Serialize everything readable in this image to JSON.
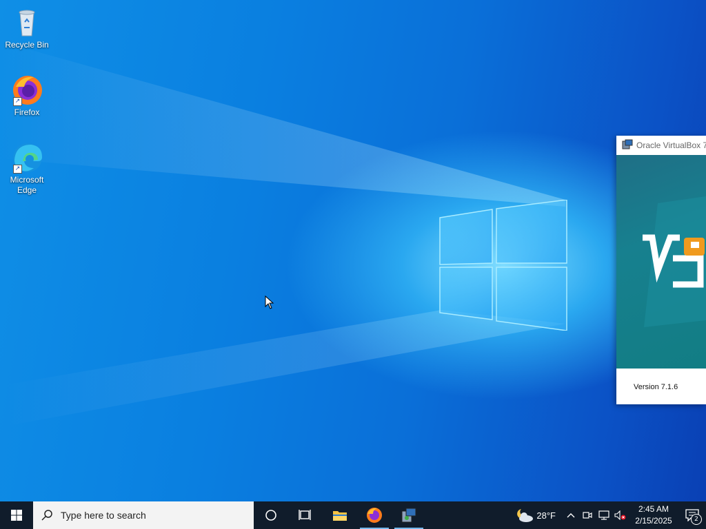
{
  "desktop": {
    "icons": [
      {
        "label": "Recycle Bin",
        "icon": "recycle-bin-icon"
      },
      {
        "label": "Firefox",
        "icon": "firefox-icon"
      },
      {
        "label": "Microsoft Edge",
        "icon": "edge-icon"
      }
    ]
  },
  "splash": {
    "title": "Oracle VirtualBox 7",
    "version": "Version 7.1.6"
  },
  "taskbar": {
    "search_placeholder": "Type here to search",
    "apps": [
      {
        "name": "task-view",
        "icon": "task-view-icon"
      },
      {
        "name": "file-explorer",
        "icon": "folder-icon"
      },
      {
        "name": "firefox",
        "icon": "firefox-icon",
        "active": true
      },
      {
        "name": "virtualbox-installer",
        "icon": "installer-icon",
        "active": true
      }
    ],
    "weather": {
      "temp": "28°F",
      "icon": "partly-cloudy-night-icon"
    },
    "clock": {
      "time": "2:45 AM",
      "date": "2/15/2025"
    },
    "notifications": {
      "count": "2"
    }
  },
  "colors": {
    "taskbar": "#101c2b",
    "accent": "#76b9ed",
    "desktop_blue": "#0a7fe0"
  }
}
